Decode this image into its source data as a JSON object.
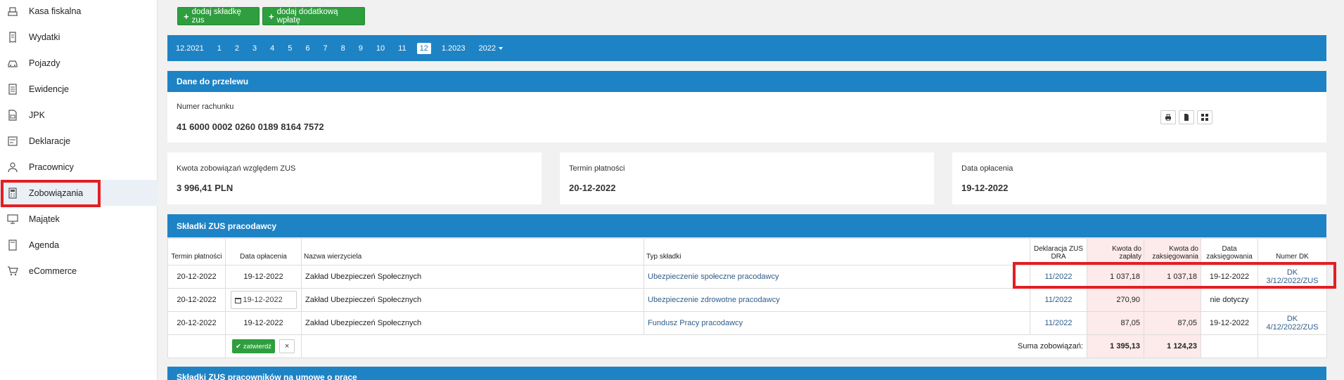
{
  "sidebar": {
    "items": [
      {
        "label": "Kasa fiskalna",
        "icon": "cash-register-icon"
      },
      {
        "label": "Wydatki",
        "icon": "receipt-icon"
      },
      {
        "label": "Pojazdy",
        "icon": "car-icon"
      },
      {
        "label": "Ewidencje",
        "icon": "document-list-icon"
      },
      {
        "label": "JPK",
        "icon": "jpk-file-icon"
      },
      {
        "label": "Deklaracje",
        "icon": "declaration-icon"
      },
      {
        "label": "Pracownicy",
        "icon": "employees-icon"
      },
      {
        "label": "Zobowiązania",
        "icon": "calculator-icon"
      },
      {
        "label": "Majątek",
        "icon": "monitor-icon"
      },
      {
        "label": "Agenda",
        "icon": "agenda-icon"
      },
      {
        "label": "eCommerce",
        "icon": "cart-icon"
      }
    ],
    "active_label": "Zobowiązania"
  },
  "actions": {
    "add_zus": "dodaj składkę zus",
    "add_extra": "dodaj dodatkową wpłatę"
  },
  "months": {
    "prev": "12.2021",
    "list": [
      "1",
      "2",
      "3",
      "4",
      "5",
      "6",
      "7",
      "8",
      "9",
      "10",
      "11",
      "12"
    ],
    "current": "12",
    "next": "1.2023",
    "year": "2022"
  },
  "transfer": {
    "title": "Dane do przelewu",
    "account_label": "Numer rachunku",
    "account_number": "41 6000 0002 0260 0189 8164 7572",
    "tools": [
      "print-icon",
      "file-icon",
      "qr-code-icon"
    ]
  },
  "summary": {
    "amount_label": "Kwota zobowiązań względem ZUS",
    "amount_value": "3 996,41 PLN",
    "due_label": "Termin płatności",
    "due_value": "20-12-2022",
    "paid_label": "Data opłacenia",
    "paid_value": "19-12-2022"
  },
  "employer_table": {
    "title": "Składki ZUS pracodawcy",
    "headers": [
      "Termin płatności",
      "Data opłacenia",
      "Nazwa wierzyciela",
      "Typ składki",
      "Deklaracja ZUS DRA",
      "Kwota do zapłaty",
      "Kwota do zaksięgowania",
      "Data zaksięgowania",
      "Numer DK"
    ],
    "rows": [
      {
        "termin": "20-12-2022",
        "oplacenie": "19-12-2022",
        "wierzyciel": "Zakład Ubezpieczeń Społecznych",
        "typ": "Ubezpieczenie społeczne pracodawcy",
        "dra": "11/2022",
        "kwota": "1 037,18",
        "zaksieg_kwota": "1 037,18",
        "data_zaksieg": "19-12-2022",
        "dk": "DK 3/12/2022/ZUS"
      },
      {
        "termin": "20-12-2022",
        "oplacenie": "19-12-2022",
        "wierzyciel": "Zakład Ubezpieczeń Społecznych",
        "typ": "Ubezpieczenie zdrowotne pracodawcy",
        "dra": "11/2022",
        "kwota": "270,90",
        "zaksieg_kwota": "",
        "data_zaksieg": "nie dotyczy",
        "dk": ""
      },
      {
        "termin": "20-12-2022",
        "oplacenie": "19-12-2022",
        "wierzyciel": "Zakład Ubezpieczeń Społecznych",
        "typ": "Fundusz Pracy pracodawcy",
        "dra": "11/2022",
        "kwota": "87,05",
        "zaksieg_kwota": "87,05",
        "data_zaksieg": "19-12-2022",
        "dk": "DK 4/12/2022/ZUS"
      }
    ],
    "confirm_label": "zatwierdź",
    "cancel_label": "×",
    "sum_label": "Suma zobowiązań:",
    "sum_kwota": "1 395,13",
    "sum_zaksieg": "1 124,23"
  },
  "employees_panel": {
    "title": "Składki ZUS pracowników na umowę o pracę"
  }
}
